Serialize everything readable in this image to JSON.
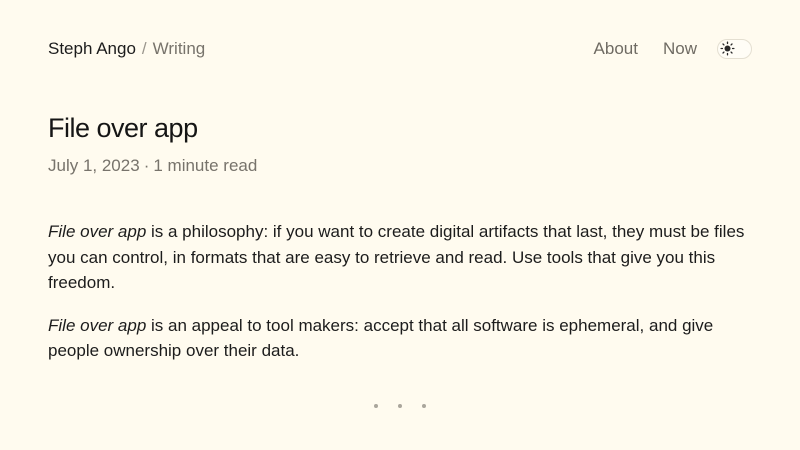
{
  "header": {
    "site_name": "Steph Ango",
    "separator": "/",
    "section": "Writing",
    "nav": [
      {
        "label": "About"
      },
      {
        "label": "Now"
      }
    ],
    "theme_toggle_icon": "sun-icon"
  },
  "article": {
    "title": "File over app",
    "date": "July 1, 2023",
    "meta_separator": "·",
    "read_time": "1 minute read",
    "paragraphs": [
      {
        "emphasis": "File over app",
        "text": " is a philosophy: if you want to create digital artifacts that last, they must be files you can control, in formats that are easy to retrieve and read. Use tools that give you this freedom."
      },
      {
        "emphasis": "File over app",
        "text": " is an appeal to tool makers: accept that all software is ephemeral, and give people ownership over their data."
      }
    ]
  },
  "pager": {
    "dots": 3
  },
  "colors": {
    "background": "#fffbef",
    "text": "#1c1c1c",
    "muted": "#77736b"
  }
}
